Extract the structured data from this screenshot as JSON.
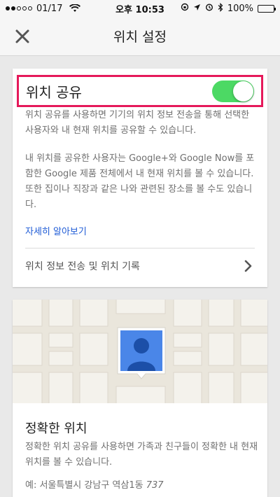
{
  "status_bar": {
    "date": "01/17",
    "time": "오후 10:53",
    "battery_text": "100%",
    "battery_level": 1.0
  },
  "app_bar": {
    "title": "위치 설정",
    "close_icon": "close-icon"
  },
  "location_sharing": {
    "label": "위치 공유",
    "toggle_on": true,
    "description_1": "위치 공유를 사용하면 기기의 위치 정보 전송을 통해 선택한 사용자와 내 현재 위치를 공유할 수 있습니다.",
    "description_2": "내 위치를 공유한 사용자는 Google+와 Google Now를 포함한 Google 제품 전체에서 내 현재 위치를 볼 수 있습니다. 또한 집이나 직장과 같은 나와 관련된 장소를 볼 수도 있습니다.",
    "learn_more": "자세히 알아보기",
    "history_label": "위치 정보 전송 및 위치 기록"
  },
  "precise_location": {
    "title": "정확한 위치",
    "description": "정확한 위치 공유를 사용하면 가족과 친구들이 정확한 내 현재 위치를 볼 수 있습니다.",
    "example_prefix": "예: 서울특별시 강남구 역삼1동",
    "example_number": "737"
  },
  "colors": {
    "toggle_on": "#4cd964",
    "highlight_border": "#e5195a",
    "link": "#1e5bd6",
    "pin_blue": "#4a86e8"
  }
}
